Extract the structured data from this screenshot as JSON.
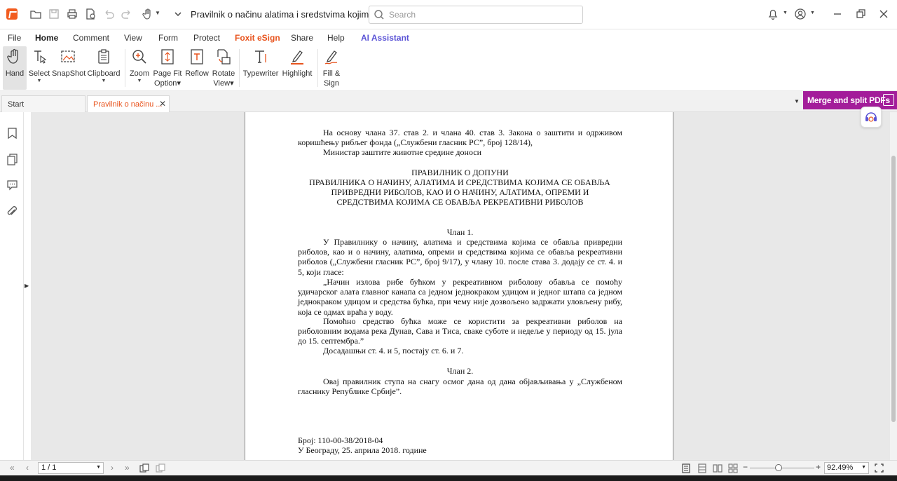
{
  "titlebar": {
    "doc_title": "Pravilnik o načinu alatima i sredstvima kojima se oba...",
    "search_placeholder": "Search"
  },
  "menu": {
    "items": [
      "File",
      "Home",
      "Comment",
      "View",
      "Form",
      "Protect",
      "Foxit eSign",
      "Share",
      "Help",
      "AI Assistant"
    ],
    "active": "Home"
  },
  "ribbon": {
    "hand": "Hand",
    "select": "Select",
    "snapshot": "SnapShot",
    "clipboard": "Clipboard",
    "zoom": "Zoom",
    "page_fit_1": "Page Fit",
    "page_fit_2": "Option",
    "reflow": "Reflow",
    "rotate_1": "Rotate",
    "rotate_2": "View",
    "typewriter": "Typewriter",
    "highlight": "Highlight",
    "fill_sign_1": "Fill &",
    "fill_sign_2": "Sign"
  },
  "tabs": {
    "start": "Start",
    "doc": "Pravilnik o načinu ...",
    "merge_banner": "Merge and split PDFs"
  },
  "document": {
    "intro_1": "На основу члана 37. став 2. и члана 40. став 3. Закона о заштити и одрживом коришћењу рибљег фонда („Службени гласник РС”, број 128/14),",
    "intro_2": "Министар заштите животне средине доноси",
    "title_1": "ПРАВИЛНИК О ДОПУНИ",
    "title_2": "ПРАВИЛНИКА О НАЧИНУ, АЛАТИМА И СРЕДСТВИМА КОЈИМА СЕ ОБАВЉА",
    "title_3": "ПРИВРЕДНИ РИБОЛОВ, КАО И О НАЧИНУ, АЛАТИМА, ОПРЕМИ И",
    "title_4": "СРЕДСТВИМА КОЈИМА СЕ ОБАВЉА РЕКРЕАТИВНИ РИБОЛОВ",
    "article1_heading": "Члан 1.",
    "article1_p1": "У Правилнику о начину, алатима и средствима којима се обавља привредни риболов, као и о начину, алатима, опреми и средствима којима се обавља рекреативни риболов („Службени гласник РС”, број 9/17), у члану 10. после става 3. додају се ст. 4. и 5,  који гласе:",
    "article1_p2": "„Начин излова рибе бућком у рекреативном риболову обавља се помоћу удичарског алата главног канапа са једном једнокраком удицом и једног штапа са једном једнокраком удицом и средства бућка, при чему није дозвољено задржати уловљену рибу, која се одмах враћа у воду.",
    "article1_p3": "Помоћно средство бућка може се користити за рекреативни риболов на риболовним водама река Дунав, Сава и Тиса, сваке суботе и недеље у периоду од 15. јула до 15. септембра.”",
    "article1_p4": "Досадашњи ст. 4. и 5, постају ст. 6. и 7.",
    "article2_heading": "Члан 2.",
    "article2_p1": "Овај правилник ступа на снагу осмог дана од дана објављивања у „Службеном гласнику Републике Србије”.",
    "number_line": "Број: 110-00-38/2018-04",
    "place_date": "У Београду, 25. априла 2018. године"
  },
  "statusbar": {
    "page_value": "1 / 1",
    "zoom_value": "92.49%",
    "zoom_fraction": 0.45
  },
  "colors": {
    "accent": "#e8541e",
    "esign": "#e8541e",
    "ai": "#5b54d6",
    "merge_banner": "#a31d9a"
  }
}
